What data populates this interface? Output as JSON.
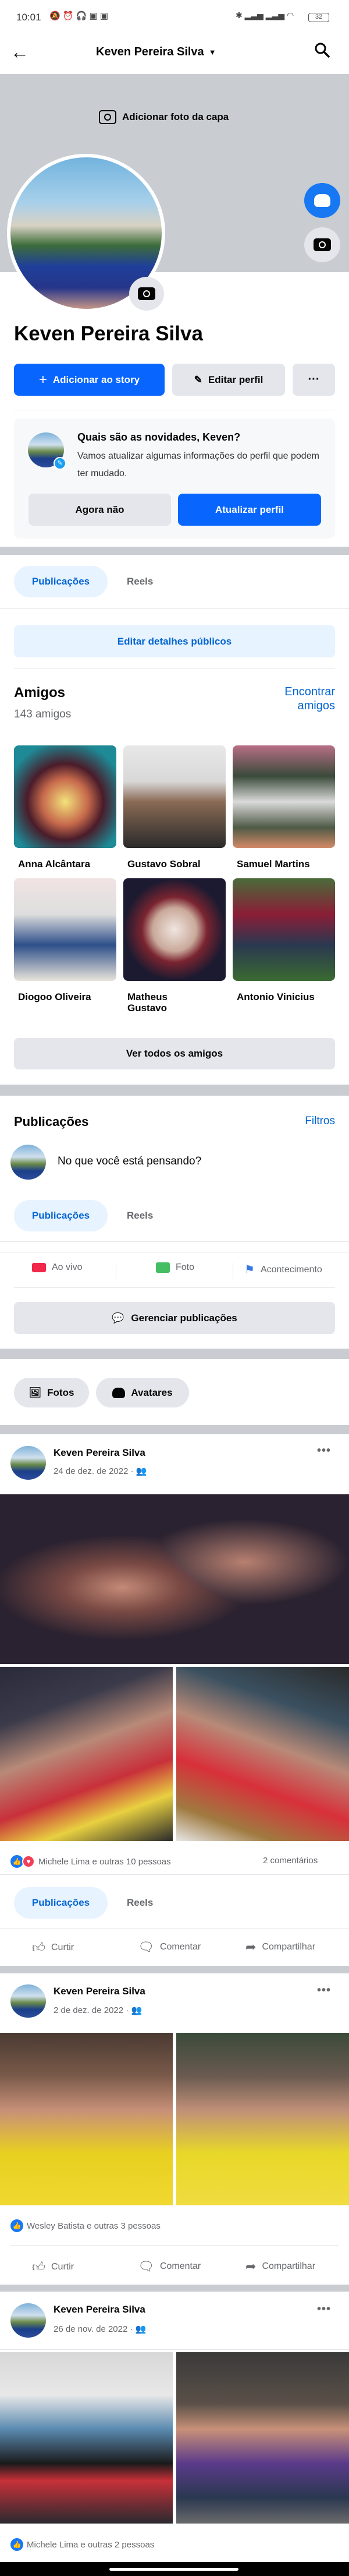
{
  "status_bar": {
    "time": "10:01",
    "battery": "32"
  },
  "header": {
    "title": "Keven Pereira Silva"
  },
  "cover": {
    "add_cover_label": "Adicionar foto da capa"
  },
  "profile": {
    "name": "Keven Pereira Silva",
    "add_story_label": "Adicionar ao story",
    "edit_profile_label": "Editar perfil",
    "more_label": "···"
  },
  "update_card": {
    "title": "Quais são as novidades, Keven?",
    "text": "Vamos atualizar algumas informações do perfil que podem ter mudado.",
    "dismiss_label": "Agora não",
    "update_label": "Atualizar perfil"
  },
  "tabs": {
    "posts": "Publicações",
    "reels": "Reels"
  },
  "edit_public_details": "Editar detalhes públicos",
  "friends": {
    "title": "Amigos",
    "count": "143 amigos",
    "find_label": "Encontrar amigos",
    "see_all_label": "Ver todos os amigos",
    "items": [
      {
        "name": "Anna Alcântara"
      },
      {
        "name": "Gustavo Sobral"
      },
      {
        "name": "Samuel Martins"
      },
      {
        "name": "Diogoo Oliveira"
      },
      {
        "name": "Matheus Gustavo"
      },
      {
        "name": "Antonio Vinicius"
      }
    ]
  },
  "posts_section": {
    "title": "Publicações",
    "filters_label": "Filtros",
    "composer_placeholder": "No que você está pensando?",
    "live_label": "Ao vivo",
    "photo_label": "Foto",
    "event_label": "Acontecimento",
    "manage_label": "Gerenciar publicações",
    "photos_chip": "Fotos",
    "avatars_chip": "Avatares"
  },
  "actions": {
    "like": "Curtir",
    "comment": "Comentar",
    "share": "Compartilhar"
  },
  "posts": [
    {
      "author": "Keven Pereira Silva",
      "date": "24 de dez. de 2022 ·",
      "reactions": "Michele Lima e outras 10 pessoas",
      "comments": "2 comentários"
    },
    {
      "author": "Keven Pereira Silva",
      "date": "2 de dez. de 2022 ·",
      "reactions": "Wesley Batista e outras 3 pessoas"
    },
    {
      "author": "Keven Pereira Silva",
      "date": "26 de nov. de 2022 ·",
      "reactions": "Michele Lima e outras 2 pessoas"
    }
  ],
  "colors": {
    "accent": "#0866ff",
    "link": "#0064d1",
    "separator": "#c9ccd1"
  }
}
